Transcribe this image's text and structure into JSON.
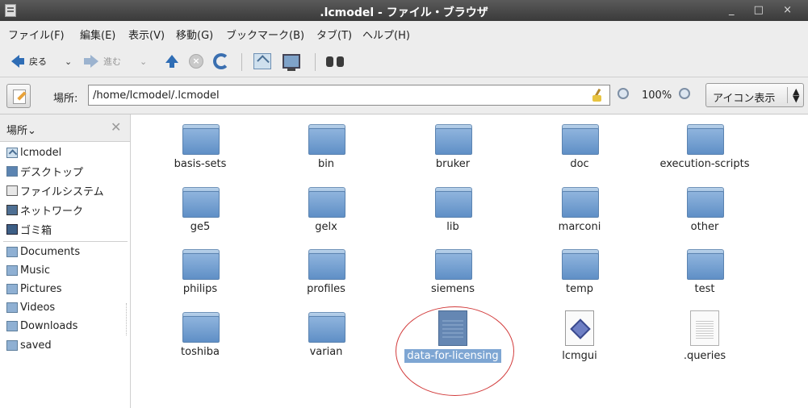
{
  "window": {
    "title": ".lcmodel - ファイル・ブラウザ",
    "controls": "_ □ ×"
  },
  "menu": [
    "ファイル(F)",
    "編集(E)",
    "表示(V)",
    "移動(G)",
    "ブックマーク(B)",
    "タブ(T)",
    "ヘルプ(H)"
  ],
  "toolbar": {
    "back": "戻る",
    "forward": "進む",
    "back_caret": "⌄",
    "forward_caret": "⌄"
  },
  "location": {
    "label": "場所:",
    "path": "/home/lcmodel/.lcmodel",
    "zoom": "100%",
    "view_mode": "アイコン表示",
    "view_arrows": "▲\n▼"
  },
  "sidebar": {
    "title": "場所⌄",
    "close": "✕",
    "places": [
      {
        "label": "lcmodel",
        "icon": "home-folder-icon"
      },
      {
        "label": "デスクトップ",
        "icon": "desktop-icon"
      },
      {
        "label": "ファイルシステム",
        "icon": "filesystem-icon"
      },
      {
        "label": "ネットワーク",
        "icon": "network-icon"
      },
      {
        "label": "ゴミ箱",
        "icon": "trash-icon"
      }
    ],
    "bookmarks": [
      {
        "label": "Documents",
        "icon": "documents-folder-icon"
      },
      {
        "label": "Music",
        "icon": "music-folder-icon"
      },
      {
        "label": "Pictures",
        "icon": "pictures-folder-icon"
      },
      {
        "label": "Videos",
        "icon": "videos-folder-icon"
      },
      {
        "label": "Downloads",
        "icon": "downloads-folder-icon"
      },
      {
        "label": "saved",
        "icon": "folder-icon"
      }
    ]
  },
  "files": [
    {
      "name": "basis-sets",
      "type": "folder"
    },
    {
      "name": "bin",
      "type": "folder"
    },
    {
      "name": "bruker",
      "type": "folder"
    },
    {
      "name": "doc",
      "type": "folder"
    },
    {
      "name": "execution-scripts",
      "type": "folder"
    },
    {
      "name": "ge5",
      "type": "folder"
    },
    {
      "name": "gelx",
      "type": "folder"
    },
    {
      "name": "lib",
      "type": "folder"
    },
    {
      "name": "marconi",
      "type": "folder"
    },
    {
      "name": "other",
      "type": "folder"
    },
    {
      "name": "philips",
      "type": "folder"
    },
    {
      "name": "profiles",
      "type": "folder"
    },
    {
      "name": "siemens",
      "type": "folder"
    },
    {
      "name": "temp",
      "type": "folder"
    },
    {
      "name": "test",
      "type": "folder"
    },
    {
      "name": "toshiba",
      "type": "folder"
    },
    {
      "name": "varian",
      "type": "folder"
    },
    {
      "name": "data-for-licensing",
      "type": "document",
      "selected": true
    },
    {
      "name": "lcmgui",
      "type": "executable"
    },
    {
      "name": ".queries",
      "type": "text"
    }
  ],
  "colors": {
    "selection": "#7ea6d3",
    "highlight_ellipse": "#d23b3b",
    "folder": "#6f9bcd"
  }
}
